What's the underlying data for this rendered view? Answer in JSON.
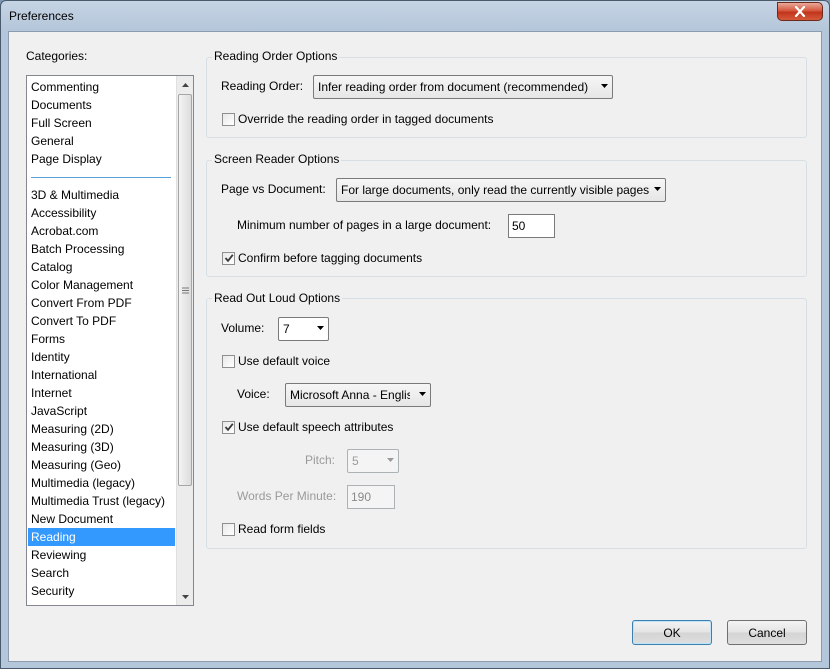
{
  "window": {
    "title": "Preferences"
  },
  "categories": {
    "label": "Categories:",
    "selected": "Reading",
    "items": [
      "Commenting",
      "Documents",
      "Full Screen",
      "General",
      "Page Display",
      "3D & Multimedia",
      "Accessibility",
      "Acrobat.com",
      "Batch Processing",
      "Catalog",
      "Color Management",
      "Convert From PDF",
      "Convert To PDF",
      "Forms",
      "Identity",
      "International",
      "Internet",
      "JavaScript",
      "Measuring (2D)",
      "Measuring (3D)",
      "Measuring (Geo)",
      "Multimedia (legacy)",
      "Multimedia Trust (legacy)",
      "New Document",
      "Reading",
      "Reviewing",
      "Search",
      "Security"
    ]
  },
  "reading_order": {
    "title": "Reading Order Options",
    "order_label": "Reading Order:",
    "order_value": "Infer reading order from document (recommended)",
    "override_label": "Override the reading order in tagged documents",
    "override_checked": false
  },
  "screen_reader": {
    "title": "Screen Reader Options",
    "page_vs_doc_label": "Page vs Document:",
    "page_vs_doc_value": "For large documents, only read the currently visible pages",
    "min_pages_label": "Minimum number of pages in a large document:",
    "min_pages_value": "50",
    "confirm_label": "Confirm before tagging documents",
    "confirm_checked": true
  },
  "read_out_loud": {
    "title": "Read Out Loud Options",
    "volume_label": "Volume:",
    "volume_value": "7",
    "default_voice_label": "Use default voice",
    "default_voice_checked": false,
    "voice_label": "Voice:",
    "voice_value": "Microsoft Anna - Englis",
    "default_speech_label": "Use default speech attributes",
    "default_speech_checked": true,
    "pitch_label": "Pitch:",
    "pitch_value": "5",
    "wpm_label": "Words Per Minute:",
    "wpm_value": "190",
    "form_fields_label": "Read form fields",
    "form_fields_checked": false
  },
  "buttons": {
    "ok": "OK",
    "cancel": "Cancel"
  }
}
